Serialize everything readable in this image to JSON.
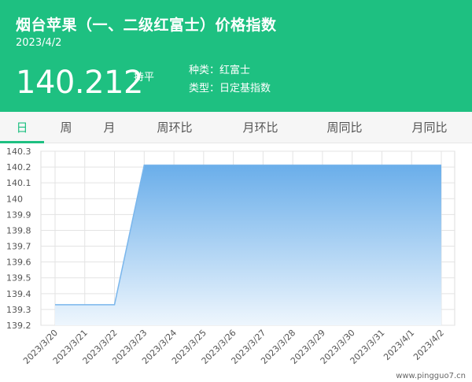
{
  "header": {
    "title": "烟台苹果（一、二级红富士）价格指数",
    "date": "2023/4/2",
    "price": "140.212",
    "trend": "持平",
    "variety": "种类：红富士",
    "type": "类型：日定基指数"
  },
  "tabs": [
    {
      "label": "日",
      "active": true
    },
    {
      "label": "周",
      "active": false
    },
    {
      "label": "月",
      "active": false
    },
    {
      "label": "周环比",
      "active": false
    },
    {
      "label": "月环比",
      "active": false
    },
    {
      "label": "周同比",
      "active": false
    },
    {
      "label": "月同比",
      "active": false
    }
  ],
  "colors": {
    "accent": "#1ec081",
    "area_top": "#6aaeea",
    "area_bottom": "#eef6fd",
    "line": "#7ab6ec"
  },
  "watermark": "www.pingguo7.cn",
  "chart_data": {
    "type": "area",
    "title": "",
    "xlabel": "",
    "ylabel": "",
    "x": [
      "2023/3/20",
      "2023/3/21",
      "2023/3/22",
      "2023/3/23",
      "2023/3/24",
      "2023/3/25",
      "2023/3/26",
      "2023/3/27",
      "2023/3/28",
      "2023/3/29",
      "2023/3/30",
      "2023/3/31",
      "2023/4/1",
      "2023/4/2"
    ],
    "series": [
      {
        "values": [
          139.33,
          139.33,
          139.33,
          140.212,
          140.212,
          140.212,
          140.212,
          140.212,
          140.212,
          140.212,
          140.212,
          140.212,
          140.212,
          140.212
        ]
      }
    ],
    "yticks": [
      "140.3",
      "140.2",
      "140.1",
      "140",
      "139.9",
      "139.8",
      "139.7",
      "139.6",
      "139.5",
      "139.4",
      "139.3",
      "139.2"
    ],
    "ylim": [
      139.2,
      140.3
    ],
    "grid": true
  }
}
